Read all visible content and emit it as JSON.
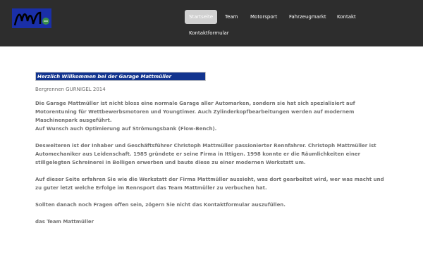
{
  "nav": {
    "items": [
      {
        "label": "Startseite",
        "active": true
      },
      {
        "label": "Team"
      },
      {
        "label": "Motorsport"
      },
      {
        "label": "Fahrzeugmarkt"
      },
      {
        "label": "Kontakt"
      },
      {
        "label": "Kontaktformular"
      }
    ]
  },
  "main": {
    "banner": "Herzlich Willkommen bei der Garage Mattmüller",
    "subtitle": "Bergrennen GURNIGEL 2014",
    "paragraphs": [
      "Die Garage Mattmüller ist nicht bloss eine normale Garage aller Automarken, sondern sie hat sich spezialisiert auf Motorentuning für Wettbewerbsmotoren und Youngtimer. Auch Zylinderkopfbearbeitungen werden auf modernem Maschinenpark ausgeführt.",
      "Auf Wunsch auch Optimierung auf Strömungsbank (Flow-Bench).",
      "Desweiteren ist der Inhaber und Geschäftsführer Christoph Mattmüller passionierter Rennfahrer. Christoph Mattmüller ist Automechaniker aus Leidenschaft. 1985 gründete er seine Firma in Ittigen. 1998 konnte er die Räumlichkeiten einer stillgelegten Schreinerei in Bolligen erwerben und baute diese zu einer modernen Werkstatt um.",
      "Auf dieser Seite erfahren Sie wie die Werkstatt der Firma Mattmüller aussieht, was dort gearbeitet wird, wer was macht und zu guter letzt welche Erfolge im Rennsport das Team Mattmüller zu verbuchen hat.",
      "Sollten danach noch Fragen offen sein, zögern Sie nicht das Kontaktformular auszufüllen.",
      "das Team Mattmüller"
    ]
  },
  "colors": {
    "topbar": "#2d2d2d",
    "banner": "#12348f",
    "logo": "#1a2fa8"
  }
}
